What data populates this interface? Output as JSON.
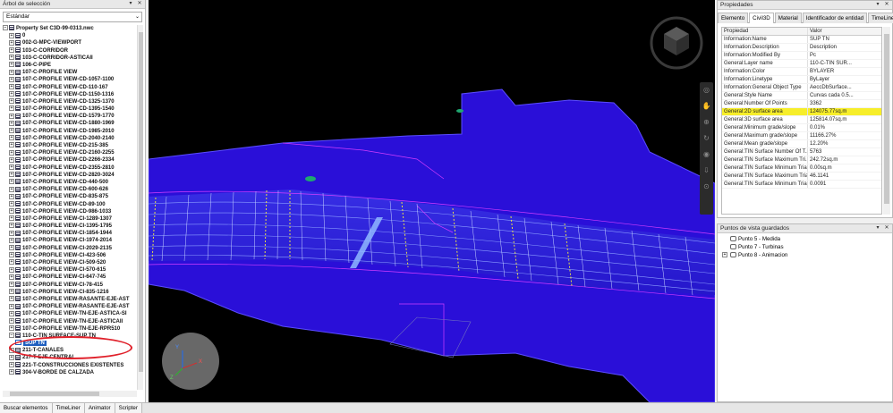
{
  "left_panel": {
    "title": "Árbol de selección",
    "dropdown_value": "Estándar",
    "tree": [
      {
        "label": "Property Set C3D-99-0313.nwc",
        "level": 0,
        "type": "file"
      },
      {
        "label": "0",
        "level": 1
      },
      {
        "label": "002-G-MPC-VIEWPORT",
        "level": 1
      },
      {
        "label": "103-C-CORRIDOR",
        "level": 1
      },
      {
        "label": "103-C-CORRIDOR-ASTICAII",
        "level": 1
      },
      {
        "label": "106-C-PIPE",
        "level": 1
      },
      {
        "label": "107-C-PROFILE VIEW",
        "level": 1
      },
      {
        "label": "107-C-PROFILE VIEW-CD-1057-1100",
        "level": 1
      },
      {
        "label": "107-C-PROFILE VIEW-CD-110-167",
        "level": 1
      },
      {
        "label": "107-C-PROFILE VIEW-CD-1150-1316",
        "level": 1
      },
      {
        "label": "107-C-PROFILE VIEW-CD-1325-1370",
        "level": 1
      },
      {
        "label": "107-C-PROFILE VIEW-CD-1395-1540",
        "level": 1
      },
      {
        "label": "107-C-PROFILE VIEW-CD-1579-1770",
        "level": 1
      },
      {
        "label": "107-C-PROFILE VIEW-CD-1880-1969",
        "level": 1
      },
      {
        "label": "107-C-PROFILE VIEW-CD-1985-2010",
        "level": 1
      },
      {
        "label": "107-C-PROFILE VIEW-CD-2040-2140",
        "level": 1
      },
      {
        "label": "107-C-PROFILE VIEW-CD-215-385",
        "level": 1
      },
      {
        "label": "107-C-PROFILE VIEW-CD-2160-2255",
        "level": 1
      },
      {
        "label": "107-C-PROFILE VIEW-CD-2266-2334",
        "level": 1
      },
      {
        "label": "107-C-PROFILE VIEW-CD-2355-2810",
        "level": 1
      },
      {
        "label": "107-C-PROFILE VIEW-CD-2820-3024",
        "level": 1
      },
      {
        "label": "107-C-PROFILE VIEW-CD-440-500",
        "level": 1
      },
      {
        "label": "107-C-PROFILE VIEW-CD-600-626",
        "level": 1
      },
      {
        "label": "107-C-PROFILE VIEW-CD-835-875",
        "level": 1
      },
      {
        "label": "107-C-PROFILE VIEW-CD-89-100",
        "level": 1
      },
      {
        "label": "107-C-PROFILE VIEW-CD-986-1033",
        "level": 1
      },
      {
        "label": "107-C-PROFILE VIEW-CI-1289-1307",
        "level": 1
      },
      {
        "label": "107-C-PROFILE VIEW-CI-1395-1795",
        "level": 1
      },
      {
        "label": "107-C-PROFILE VIEW-CI-1854-1944",
        "level": 1
      },
      {
        "label": "107-C-PROFILE VIEW-CI-1974-2014",
        "level": 1
      },
      {
        "label": "107-C-PROFILE VIEW-CI-2029-2135",
        "level": 1
      },
      {
        "label": "107-C-PROFILE VIEW-CI-423-506",
        "level": 1
      },
      {
        "label": "107-C-PROFILE VIEW-CI-509-520",
        "level": 1
      },
      {
        "label": "107-C-PROFILE VIEW-CI-570-615",
        "level": 1
      },
      {
        "label": "107-C-PROFILE VIEW-CI-647-745",
        "level": 1
      },
      {
        "label": "107-C-PROFILE VIEW-CI-78-415",
        "level": 1
      },
      {
        "label": "107-C-PROFILE VIEW-CI-835-1216",
        "level": 1
      },
      {
        "label": "107-C-PROFILE VIEW-RASANTE-EJE-AST",
        "level": 1
      },
      {
        "label": "107-C-PROFILE VIEW-RASANTE-EJE-AST",
        "level": 1
      },
      {
        "label": "107-C-PROFILE VIEW-TN-EJE-ASTICA-SI",
        "level": 1
      },
      {
        "label": "107-C-PROFILE VIEW-TN-EJE-ASTICAII",
        "level": 1
      },
      {
        "label": "107-C-PROFILE VIEW-TN-EJE-RPR510",
        "level": 1
      },
      {
        "label": "110-C-TIN SURFACE-SUP TN",
        "level": 1,
        "expanded": true
      },
      {
        "label": "SUP TN",
        "level": 2,
        "selected": true
      },
      {
        "label": "211-T-CANALES",
        "level": 1
      },
      {
        "label": "217-T-EJE CENTRAL",
        "level": 1
      },
      {
        "label": "221-T-CONSTRUCCIONES EXISTENTES",
        "level": 1
      },
      {
        "label": "304-V-BORDE DE CALZADA",
        "level": 1
      }
    ]
  },
  "properties_panel": {
    "title": "Propiedades",
    "tabs": [
      "Elemento",
      "Civil3D",
      "Material",
      "Identificador de entidad",
      "TimeLine"
    ],
    "active_tab": "Civil3D",
    "columns": {
      "key": "Propiedad",
      "value": "Valor"
    },
    "rows": [
      {
        "k": "Information:Name",
        "v": "SUP TN"
      },
      {
        "k": "Information:Description",
        "v": "Description"
      },
      {
        "k": "Information:Modified By",
        "v": "Pc"
      },
      {
        "k": "General:Layer name",
        "v": "110-C-TIN SUR..."
      },
      {
        "k": "Information:Color",
        "v": "BYLAYER"
      },
      {
        "k": "Information:Linetype",
        "v": "ByLayer"
      },
      {
        "k": "Information:General Object Type",
        "v": "AeccDbSurface..."
      },
      {
        "k": "General:Style Name",
        "v": "Curvas cada 0.5..."
      },
      {
        "k": "General:Number Of Points",
        "v": "3362"
      },
      {
        "k": "General:2D surface area",
        "v": "124075.77sq.m",
        "highlight": true
      },
      {
        "k": "General:3D surface area",
        "v": "125814.07sq.m"
      },
      {
        "k": "General:Minimum grade/slope",
        "v": "0.01%"
      },
      {
        "k": "General:Maximum grade/slope",
        "v": "11166.27%"
      },
      {
        "k": "General:Mean grade/slope",
        "v": "12.20%"
      },
      {
        "k": "General:TIN Surface Number Of T...",
        "v": "5763"
      },
      {
        "k": "General:TIN Surface Maximum Tri...",
        "v": "242.72sq.m"
      },
      {
        "k": "General:TIN Surface Minimum Tria...",
        "v": "0.00sq.m"
      },
      {
        "k": "General:TIN Surface Maximum Tria...",
        "v": "46.1141"
      },
      {
        "k": "General:TIN Surface Minimum Tria...",
        "v": "0.0091"
      }
    ]
  },
  "saved_views_panel": {
    "title": "Puntos de vista guardados",
    "items": [
      {
        "label": "Punto 5 - Medida"
      },
      {
        "label": "Punto 7 - Turbinas"
      },
      {
        "label": "Punto 8 - Animacion",
        "expandable": true
      }
    ]
  },
  "bottom_tabs": [
    "Buscar elementos",
    "TimeLiner",
    "Animator",
    "Scripter"
  ],
  "colors": {
    "surface_blue": "#2a0fd8",
    "surface_edge": "#5a4cff",
    "highlight_yellow": "#f7ee2a",
    "selection_blue": "#1f5fbf",
    "annotation_red": "#e0202a",
    "magenta_lines": "#d23cff"
  }
}
